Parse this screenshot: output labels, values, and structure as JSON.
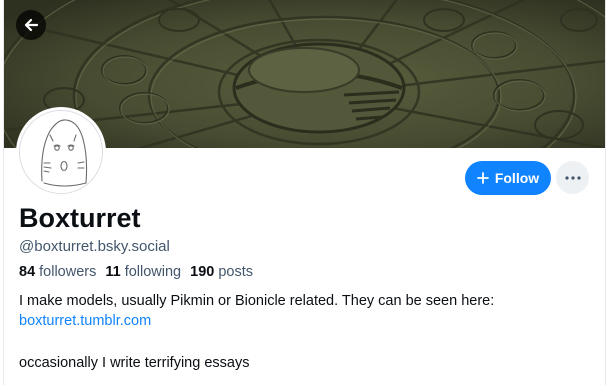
{
  "profile": {
    "display_name": "Boxturret",
    "handle": "@boxturret.bsky.social",
    "followers_count": "84",
    "followers_label": "followers",
    "following_count": "11",
    "following_label": "following",
    "posts_count": "190",
    "posts_label": "posts",
    "bio_line1": "I make models, usually Pikmin or Bionicle related. They can be seen here:",
    "bio_link": "boxturret.tumblr.com",
    "bio_line2": "occasionally I write terrifying essays"
  },
  "actions": {
    "follow_label": "Follow",
    "follow_icon": "plus-icon",
    "more_icon": "ellipsis-icon",
    "back_icon": "arrow-left-icon"
  },
  "colors": {
    "accent": "#1083fe",
    "banner": "#4b4f35",
    "muted_text": "#42566c",
    "text": "#0b0f14"
  }
}
